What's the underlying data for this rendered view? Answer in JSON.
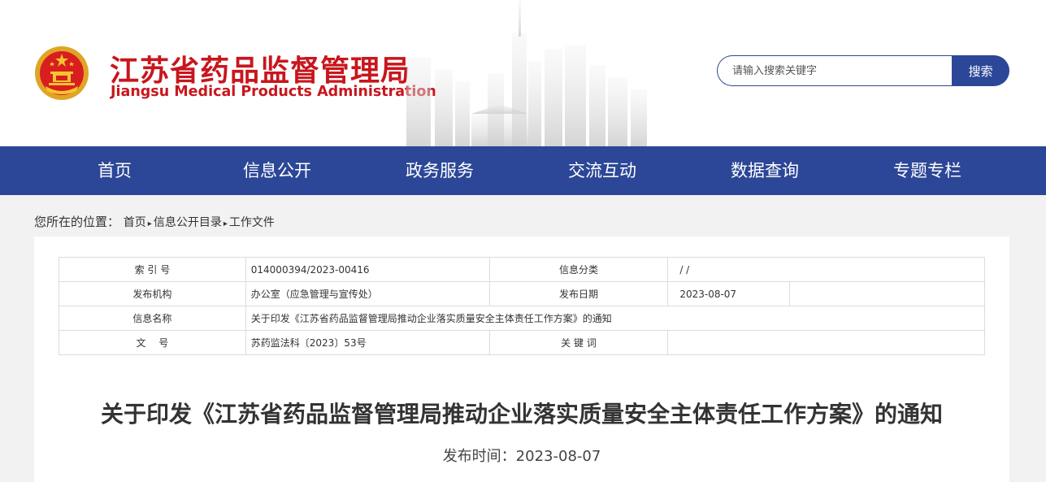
{
  "header": {
    "title_cn": "江苏省药品监督管理局",
    "title_en": "Jiangsu Medical Products Administration",
    "brand_color": "#c8161d"
  },
  "search": {
    "placeholder": "请输入搜索关键字",
    "button_label": "搜索"
  },
  "nav": {
    "items": [
      "首页",
      "信息公开",
      "政务服务",
      "交流互动",
      "数据查询",
      "专题专栏"
    ],
    "bg_color": "#2c4797"
  },
  "breadcrumb": {
    "prefix": "您所在的位置：",
    "items": [
      "首页",
      "信息公开目录",
      "工作文件"
    ],
    "separator": "▸"
  },
  "meta": {
    "index_label": "索 引 号",
    "index_value": "014000394/2023-00416",
    "category_label": "信息分类",
    "category_value": "/ /",
    "publisher_label": "发布机构",
    "publisher_value": "办公室（应急管理与宣传处）",
    "date_label": "发布日期",
    "date_value": "2023-08-07",
    "name_label": "信息名称",
    "name_value": "关于印发《江苏省药品监督管理局推动企业落实质量安全主体责任工作方案》的通知",
    "docno_label": "文　 号",
    "docno_value": "苏药监法科〔2023〕53号",
    "keywords_label": "关 键 词",
    "keywords_value": ""
  },
  "article": {
    "title": "关于印发《江苏省药品监督管理局推动企业落实质量安全主体责任工作方案》的通知",
    "publish_time": "发布时间：2023-08-07"
  }
}
